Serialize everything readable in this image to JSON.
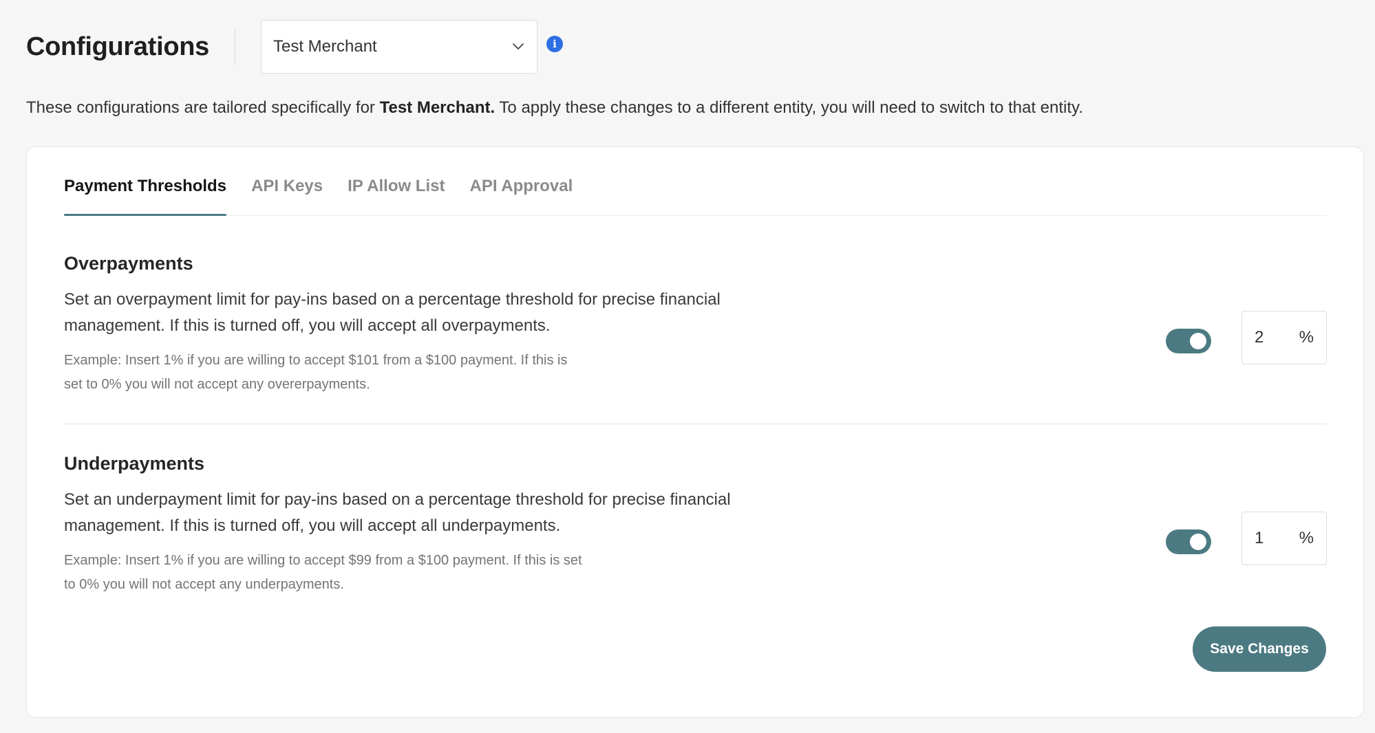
{
  "header": {
    "title": "Configurations",
    "entity_select": {
      "value": "Test Merchant",
      "icon": "chevron-down-icon"
    },
    "info_icon": "info-icon"
  },
  "intro": {
    "prefix": "These configurations are tailored specifically for ",
    "entity": "Test Merchant.",
    "suffix": " To apply these changes to a different entity, you will need to switch to that entity."
  },
  "tabs": [
    {
      "label": "Payment Thresholds",
      "active": true
    },
    {
      "label": "API Keys",
      "active": false
    },
    {
      "label": "IP Allow List",
      "active": false
    },
    {
      "label": "API Approval",
      "active": false
    }
  ],
  "overpayments": {
    "title": "Overpayments",
    "description": "Set an overpayment limit for pay-ins based on a percentage threshold for precise financial management. If this is turned off, you will accept all overpayments.",
    "example": "Example: Insert 1% if you are willing to accept $101 from a $100 payment. If this is set to 0% you will not accept any overerpayments.",
    "enabled": true,
    "value": "2",
    "unit": "%"
  },
  "underpayments": {
    "title": "Underpayments",
    "description": "Set an underpayment limit for pay-ins based on a percentage threshold for precise financial management. If this is turned off, you will accept all underpayments.",
    "example": "Example: Insert 1% if you are willing to accept $99 from a $100 payment. If this is set to 0% you will not accept any underpayments.",
    "enabled": true,
    "value": "1",
    "unit": "%"
  },
  "actions": {
    "save_label": "Save Changes"
  },
  "colors": {
    "accent": "#4c7a82",
    "info": "#2f6fe4"
  }
}
